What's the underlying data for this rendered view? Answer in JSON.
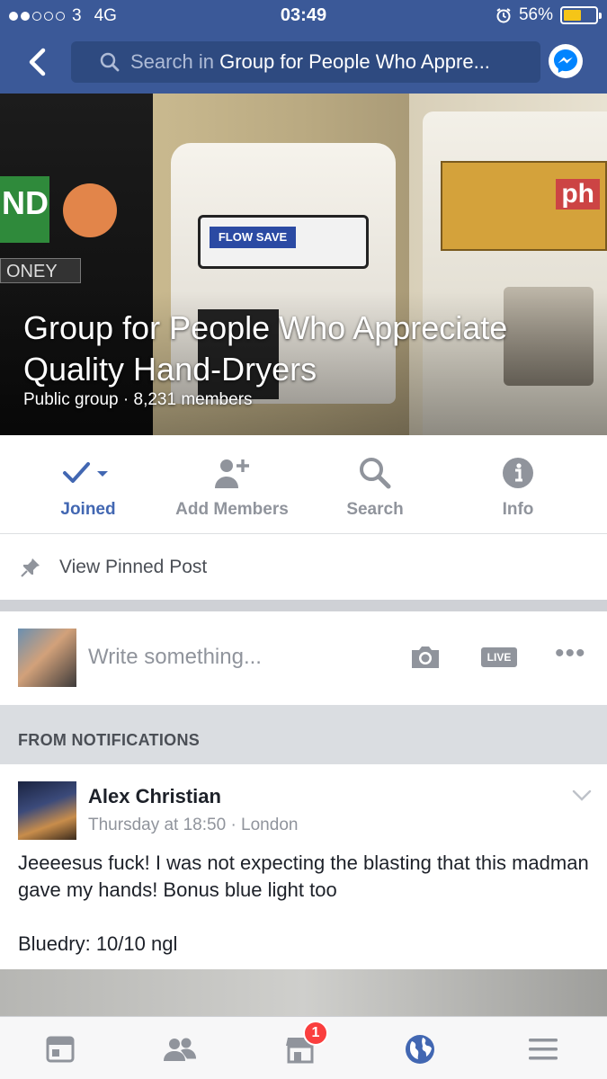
{
  "status_bar": {
    "carrier": "3",
    "network": "4G",
    "time": "03:49",
    "battery": "56%",
    "battery_level": 0.56,
    "signal_bars_filled": 2,
    "signal_bars_total": 5
  },
  "nav": {
    "search_prefix": "Search in",
    "search_target": "Group for People Who Appre..."
  },
  "cover": {
    "title": "Group for People Who Appreciate Quality Hand-Dryers",
    "subtitle": "Public group · 8,231 members",
    "sticker_green": "ND",
    "sticker_label": "ONEY",
    "dryer_brand": "FLOW SAVE",
    "dryer_plate": "ph"
  },
  "actions": [
    {
      "label": "Joined",
      "icon": "check-icon"
    },
    {
      "label": "Add Members",
      "icon": "add-person-icon"
    },
    {
      "label": "Search",
      "icon": "search-icon"
    },
    {
      "label": "Info",
      "icon": "info-icon"
    }
  ],
  "pinned": {
    "label": "View Pinned Post"
  },
  "composer": {
    "placeholder": "Write something...",
    "live_label": "LIVE"
  },
  "section_header": "FROM NOTIFICATIONS",
  "post": {
    "author": "Alex Christian",
    "timestamp": "Thursday at 18:50",
    "location": "London",
    "body_line1": "Jeeeesus fuck! I was not expecting the blasting that this madman gave my hands! Bonus blue light too",
    "body_line2": "Bluedry: 10/10 ngl"
  },
  "tabbar": {
    "tabs": [
      "news-feed-icon",
      "friends-icon",
      "marketplace-icon",
      "notifications-globe-icon",
      "menu-icon"
    ],
    "badge": "1"
  },
  "colors": {
    "brand_blue": "#3b5998",
    "link_blue": "#4267b2",
    "badge_red": "#fa3e3e"
  }
}
